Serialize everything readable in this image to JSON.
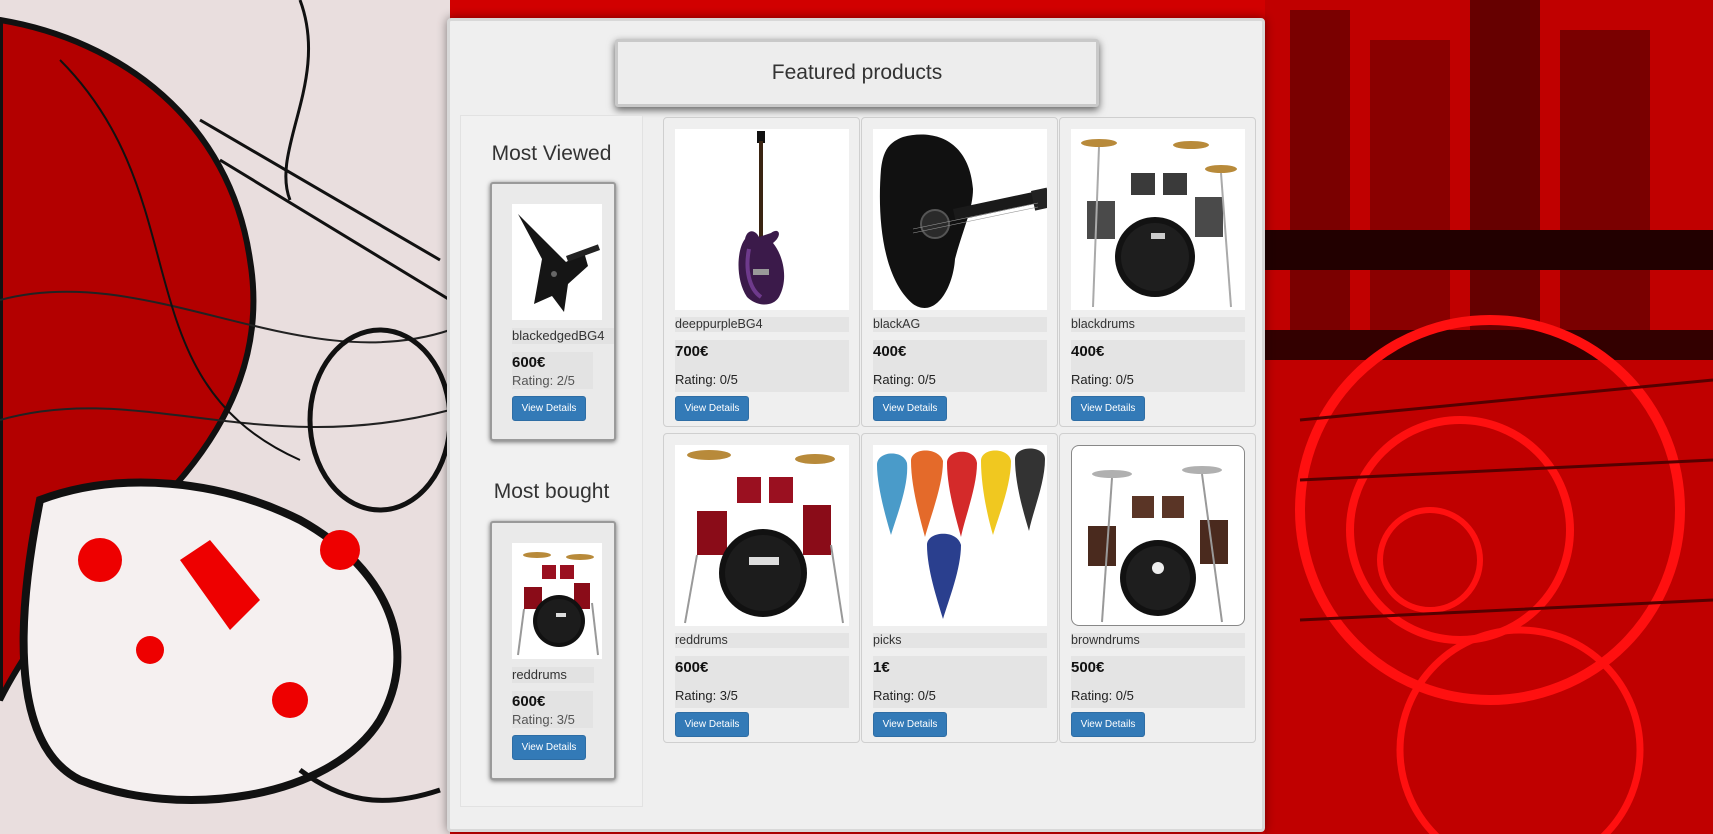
{
  "header": {
    "title": "Featured products"
  },
  "sidebar": {
    "most_viewed": {
      "title": "Most Viewed",
      "name": "blackedgedBG4",
      "price": "600€",
      "rating": "Rating: 2/5",
      "button": "View Details"
    },
    "most_bought": {
      "title": "Most bought",
      "name": "reddrums",
      "price": "600€",
      "rating": "Rating: 3/5",
      "button": "View Details"
    }
  },
  "products": [
    {
      "name": "deeppurpleBG4",
      "price": "700€",
      "rating": "Rating: 0/5",
      "button": "View Details",
      "image": "purple-bass-guitar"
    },
    {
      "name": "blackAG",
      "price": "400€",
      "rating": "Rating: 0/5",
      "button": "View Details",
      "image": "black-acoustic-guitar"
    },
    {
      "name": "blackdrums",
      "price": "400€",
      "rating": "Rating: 0/5",
      "button": "View Details",
      "image": "black-drum-kit"
    },
    {
      "name": "reddrums",
      "price": "600€",
      "rating": "Rating: 3/5",
      "button": "View Details",
      "image": "red-drum-kit"
    },
    {
      "name": "picks",
      "price": "1€",
      "rating": "Rating: 0/5",
      "button": "View Details",
      "image": "guitar-picks"
    },
    {
      "name": "browndrums",
      "price": "500€",
      "rating": "Rating: 0/5",
      "button": "View Details",
      "image": "brown-drum-kit"
    }
  ],
  "colors": {
    "button": "#337ab7",
    "background_accent": "#cc0000",
    "panel": "#efefef"
  }
}
